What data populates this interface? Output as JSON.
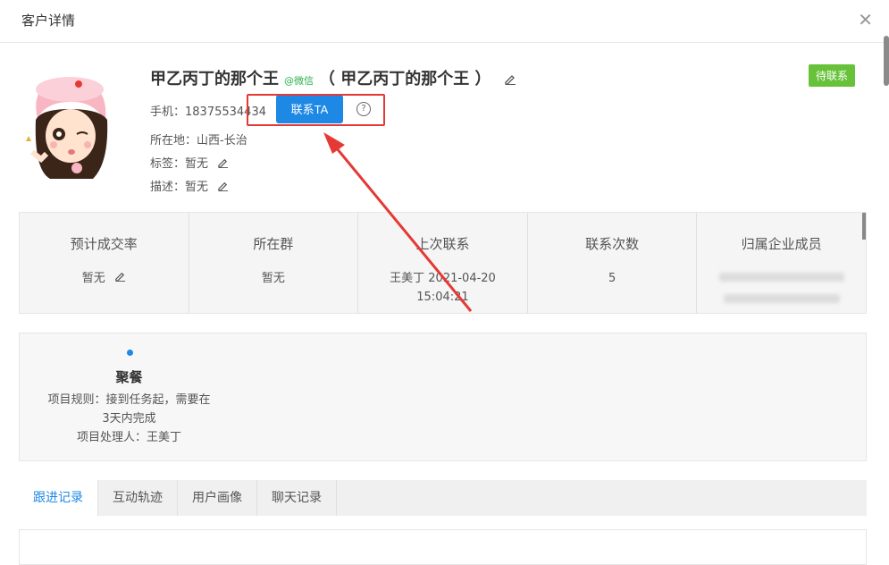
{
  "header": {
    "title": "客户详情",
    "close_icon": "close-icon"
  },
  "profile": {
    "name": "甲乙丙丁的那个王",
    "wechat_tag": "@微信",
    "alias": "（ 甲乙丙丁的那个王 ）",
    "status": "待联系",
    "phone_label": "手机：",
    "phone": "18375534434",
    "contact_button": "联系TA",
    "location_label": "所在地：",
    "location": "山西-长治",
    "tags_label": "标签：",
    "tags": "暂无",
    "desc_label": "描述：",
    "desc": "暂无"
  },
  "stats": [
    {
      "label": "预计成交率",
      "value": "暂无"
    },
    {
      "label": "所在群",
      "value": "暂无"
    },
    {
      "label": "上次联系",
      "value": "王美丁 2021-04-20",
      "value2": "15:04:21"
    },
    {
      "label": "联系次数",
      "value": "5"
    },
    {
      "label": "归属企业成员",
      "value": ""
    }
  ],
  "task": {
    "title": "聚餐",
    "rule_line1": "项目规则：接到任务起，需要在",
    "rule_line2": "3天内完成",
    "handler": "项目处理人：王美丁"
  },
  "tabs": [
    {
      "label": "跟进记录",
      "active": true
    },
    {
      "label": "互动轨迹",
      "active": false
    },
    {
      "label": "用户画像",
      "active": false
    },
    {
      "label": "聊天记录",
      "active": false
    }
  ],
  "colors": {
    "accent": "#1e88e5",
    "status_green": "#67c23a",
    "annotation_red": "#e53935"
  }
}
